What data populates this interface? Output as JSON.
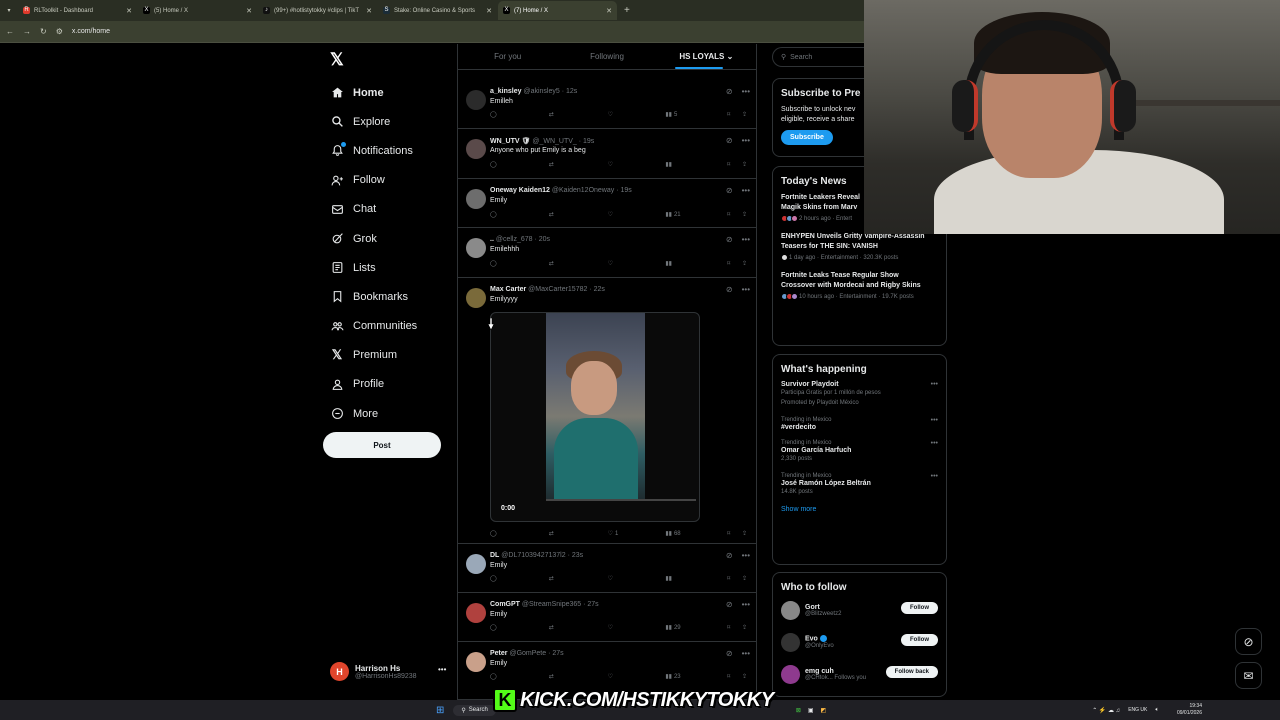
{
  "browser": {
    "tabs": [
      {
        "title": "RLToolkit - Dashboard",
        "color": "#e03a2c",
        "icon": "R"
      },
      {
        "title": "(5) Home / X",
        "color": "#000000",
        "icon": "X"
      },
      {
        "title": "(99+) #hotlistytokky #clips | TikT",
        "color": "#111111",
        "icon": "♪"
      },
      {
        "title": "Stake: Online Casino & Sports",
        "color": "#1a2c38",
        "icon": "S"
      },
      {
        "title": "(7) Home / X",
        "color": "#000000",
        "icon": "X",
        "active": true
      }
    ],
    "url": "x.com/home"
  },
  "nav": {
    "items": [
      {
        "label": "Home",
        "icon": "home-icon"
      },
      {
        "label": "Explore",
        "icon": "search-icon"
      },
      {
        "label": "Notifications",
        "icon": "bell-icon"
      },
      {
        "label": "Follow",
        "icon": "follow-icon"
      },
      {
        "label": "Chat",
        "icon": "mail-icon"
      },
      {
        "label": "Grok",
        "icon": "grok-icon"
      },
      {
        "label": "Lists",
        "icon": "list-icon"
      },
      {
        "label": "Bookmarks",
        "icon": "bookmark-icon"
      },
      {
        "label": "Communities",
        "icon": "communities-icon"
      },
      {
        "label": "Premium",
        "icon": "x-icon"
      },
      {
        "label": "Profile",
        "icon": "profile-icon"
      },
      {
        "label": "More",
        "icon": "more-icon"
      }
    ],
    "post_label": "Post",
    "account": {
      "name": "Harrison Hs",
      "handle": "@HarrisonHs89238",
      "initial": "H"
    }
  },
  "feed": {
    "tabs": {
      "for_you": "For you",
      "following": "Following",
      "list": "HS LOYALS"
    },
    "tweets": [
      {
        "name": "a_kinsley",
        "handle": "@akinsley5 · 12s",
        "text": "Emilleh",
        "views": "5",
        "likes": "",
        "avatar": "#2b2b2b"
      },
      {
        "name": "WN_UTV 🛡",
        "handle": "@_WN_UTV_ · 19s",
        "text": "Anyone who put Emily is a beg",
        "views": "",
        "likes": "",
        "avatar": "#5a4a4a"
      },
      {
        "name": "Oneway Kaiden12",
        "handle": "@Kaiden12Oneway · 19s",
        "text": "Emily",
        "views": "21",
        "likes": "",
        "avatar": "#6d6d6d"
      },
      {
        "name": "..",
        "handle": "@cellz_678 · 20s",
        "text": "Emilehhh",
        "views": "",
        "likes": "",
        "avatar": "#8a8a8a"
      },
      {
        "name": "Max Carter",
        "handle": "@MaxCarter15782 · 22s",
        "text": "Emilyyyy",
        "views": "68",
        "likes": "1",
        "avatar": "#7a6a3a"
      },
      {
        "name": "DL",
        "handle": "@DL71039427137l2 · 23s",
        "text": "Emily",
        "views": "",
        "likes": "",
        "avatar": "#9aa8b8"
      },
      {
        "name": "ComGPT",
        "handle": "@StreamSnipe365 · 27s",
        "text": "Emily",
        "views": "29",
        "likes": "",
        "avatar": "#b0413e"
      },
      {
        "name": "Peter",
        "handle": "@GomPete · 27s",
        "text": "Emily",
        "views": "23",
        "likes": "",
        "avatar": "#c9a08a"
      }
    ],
    "video_time": "0:00"
  },
  "right": {
    "search_placeholder": "Search",
    "premium": {
      "title": "Subscribe to Pre",
      "text1": "Subscribe to unlock nev",
      "text2": "eligible, receive a share",
      "button": "Subscribe"
    },
    "news": {
      "title": "Today's News",
      "items": [
        {
          "title1": "Fortnite Leakers Reveal",
          "title2": "Magik Skins from Marv",
          "meta": "2 hours ago · Entert"
        },
        {
          "title1": "ENHYPEN Unveils Gritty Vampire-Assassin",
          "title2": "Teasers for THE SIN: VANISH",
          "meta": "1 day ago · Entertainment · 320.3K posts"
        },
        {
          "title1": "Fortnite Leaks Tease Regular Show",
          "title2": "Crossover with Mordecai and Rigby Skins",
          "meta": "10 hours ago · Entertainment · 19.7K posts"
        }
      ]
    },
    "happening": {
      "title": "What's happening",
      "items": [
        {
          "cat": "",
          "name": "Survivor Playdoit",
          "desc": "Participa Gratis por 1 millón de pesos",
          "extra": "Promoted by Playdoit México"
        },
        {
          "cat": "Trending in Mexico",
          "name": "#verdecito",
          "desc": "",
          "extra": ""
        },
        {
          "cat": "Trending in Mexico",
          "name": "Omar García Harfuch",
          "desc": "2,330 posts",
          "extra": ""
        },
        {
          "cat": "Trending in Mexico",
          "name": "José Ramón López Beltrán",
          "desc": "14.8K posts",
          "extra": ""
        }
      ],
      "show_more": "Show more"
    },
    "who_to_follow": {
      "title": "Who to follow",
      "items": [
        {
          "name": "Gort",
          "handle": "@Blitzweetz2",
          "button": "Follow",
          "avatar": "#888888"
        },
        {
          "name": "Evo",
          "handle": "@OnlyEvo",
          "button": "Follow",
          "avatar": "#333333",
          "verified": true
        },
        {
          "name": "emg cuh",
          "handle": "@CHtok... Follows you",
          "button": "Follow back",
          "avatar": "#8e3a8e"
        }
      ]
    }
  },
  "overlay": {
    "kick_text": "KICK.COM/HSTIKKYTOKKY",
    "kick_letter": "K"
  },
  "taskbar": {
    "search": "Search",
    "lang": "ENG UK",
    "time": "19:34",
    "date": "09/01/2026"
  }
}
